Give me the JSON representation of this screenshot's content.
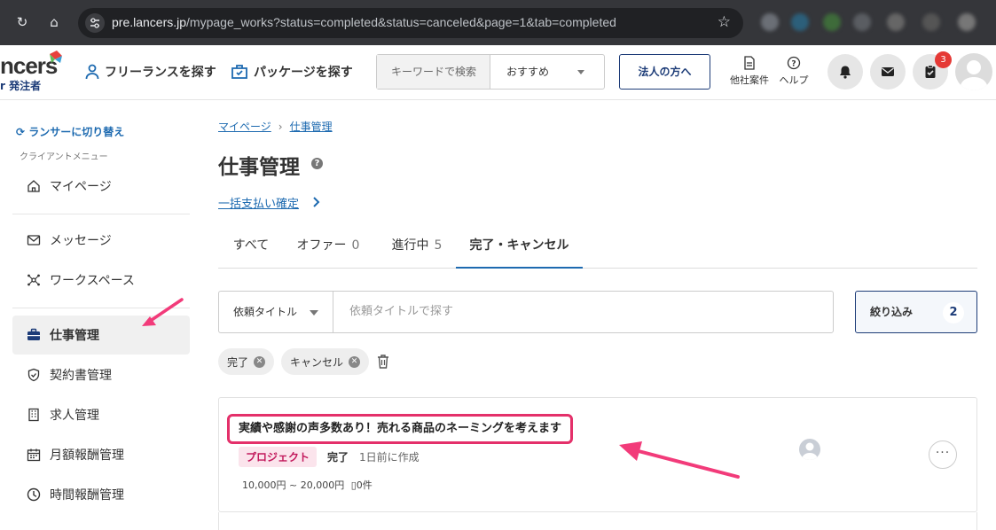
{
  "browser": {
    "url_host": "pre.lancers.jp",
    "url_path": "/mypage_works?status=completed&status=canceled&page=1&tab=completed"
  },
  "header": {
    "logo_text": "ncers",
    "logo_sub": "r 発注者",
    "nav": [
      "フリーランスを探す",
      "パッケージを探す"
    ],
    "keyword_placeholder": "キーワードで検索",
    "sort_label": "おすすめ",
    "corp_button": "法人の方へ",
    "other_jobs": "他社案件",
    "help": "ヘルプ",
    "badge_count": "3"
  },
  "sidebar": {
    "switch_label": "ランサーに切り替え",
    "menu_caption": "クライアントメニュー",
    "items": [
      {
        "label": "マイページ",
        "icon": "home-icon"
      },
      {
        "label": "メッセージ",
        "icon": "mail-icon"
      },
      {
        "label": "ワークスペース",
        "icon": "workspace-icon"
      },
      {
        "label": "仕事管理",
        "icon": "briefcase-icon"
      },
      {
        "label": "契約書管理",
        "icon": "shield-check-icon"
      },
      {
        "label": "求人管理",
        "icon": "building-icon"
      },
      {
        "label": "月額報酬管理",
        "icon": "calendar-icon"
      },
      {
        "label": "時間報酬管理",
        "icon": "clock-icon"
      }
    ]
  },
  "main": {
    "breadcrumb": [
      "マイページ",
      "仕事管理"
    ],
    "title": "仕事管理",
    "help_mark": "?",
    "bulk_link": "一括支払い確定",
    "tabs": [
      {
        "label": "すべて",
        "count": ""
      },
      {
        "label": "オファー",
        "count": "0"
      },
      {
        "label": "進行中",
        "count": "5"
      },
      {
        "label": "完了・キャンセル",
        "count": ""
      }
    ],
    "filter": {
      "field_label": "依頼タイトル",
      "input_placeholder": "依頼タイトルで探す",
      "narrow_label": "絞り込み",
      "narrow_count": "2"
    },
    "chips": [
      "完了",
      "キャンセル"
    ],
    "job": {
      "title": "実績や感謝の声多数あり！売れる商品のネーミングを考えます",
      "type": "プロジェクト",
      "status": "完了",
      "created": "1日前に作成",
      "price": "10,000円 ~ 20,000円",
      "proposals": "0件",
      "more": "···"
    }
  },
  "colors": {
    "brand_navy": "#1d3c78",
    "link_blue": "#1d6ab0",
    "highlight_pink": "#e4306a",
    "badge_red": "#e53935"
  }
}
